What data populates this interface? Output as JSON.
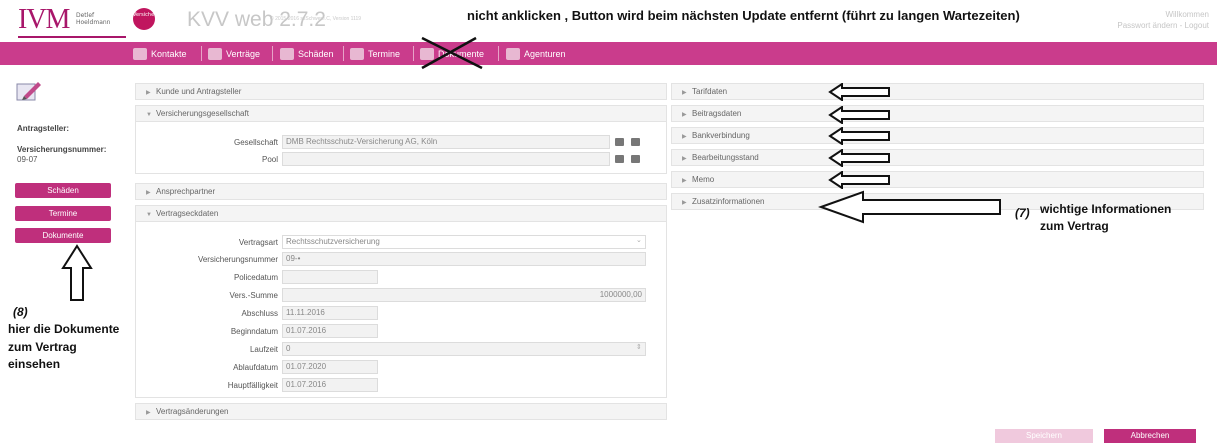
{
  "header": {
    "logo_text": "IVM",
    "logo_sub": "Detlef Hoeldmann",
    "badge_text": "Versicherungsmakler",
    "app_title": "KVV web 2.7.2",
    "copyright": "© 2015-2016 ssSchwere.C, Version 1119",
    "warning": "nicht anklicken , Button wird beim nächsten Update entfernt  (führt zu langen Wartezeiten)",
    "user_greeting": "Willkommen",
    "user_links": "Passwort ändern - Logout"
  },
  "nav": {
    "items": [
      {
        "label": "Kontakte",
        "icon": "contacts-icon"
      },
      {
        "label": "Verträge",
        "icon": "contracts-icon"
      },
      {
        "label": "Schäden",
        "icon": "damage-icon"
      },
      {
        "label": "Termine",
        "icon": "calendar-icon"
      },
      {
        "label": "Dokumente",
        "icon": "documents-icon"
      },
      {
        "label": "Agenturen",
        "icon": "agencies-icon"
      }
    ]
  },
  "left": {
    "antragsteller_label": "Antragsteller:",
    "versnr_label": "Versicherungsnummer:",
    "versnr_value": "09-07",
    "buttons": [
      "Schäden",
      "Termine",
      "Dokumente"
    ]
  },
  "annotations": {
    "left_num": "(8)",
    "left_text1": "hier die Dokumente",
    "left_text2": "zum Vertrag",
    "left_text3": "einsehen",
    "right_num": "(7)",
    "right_text1": "wichtige Informationen",
    "right_text2": "zum Vertrag"
  },
  "panels_left": {
    "kunde": "Kunde und Antragsteller",
    "versges": "Versicherungsgesellschaft",
    "ansprech": "Ansprechpartner",
    "eckdaten": "Vertragseckdaten",
    "aenderungen": "Vertragsänderungen"
  },
  "versges_fields": {
    "gesellschaft_label": "Gesellschaft",
    "gesellschaft_value": "DMB Rechtsschutz-Versicherung AG, Köln",
    "pool_label": "Pool",
    "pool_value": ""
  },
  "eckdaten_fields": [
    {
      "label": "Vertragsart",
      "value": "Rechtsschutzversicherung"
    },
    {
      "label": "Versicherungsnummer",
      "value": "09-•"
    },
    {
      "label": "Policedatum",
      "value": ""
    },
    {
      "label": "Vers.-Summe",
      "value": "1000000,00"
    },
    {
      "label": "Abschluss",
      "value": "11.11.2016"
    },
    {
      "label": "Beginndatum",
      "value": "01.07.2016"
    },
    {
      "label": "Laufzeit",
      "value": "0"
    },
    {
      "label": "Ablaufdatum",
      "value": "01.07.2020"
    },
    {
      "label": "Hauptfälligkeit",
      "value": "01.07.2016"
    }
  ],
  "panels_right": [
    "Tarifdaten",
    "Beitragsdaten",
    "Bankverbindung",
    "Bearbeitungsstand",
    "Memo",
    "Zusatzinformationen"
  ],
  "footer": {
    "save_label": "Speichern",
    "cancel_label": "Abbrechen"
  },
  "colors": {
    "brand": "#ca3c8c",
    "button": "#bf2f7c"
  }
}
